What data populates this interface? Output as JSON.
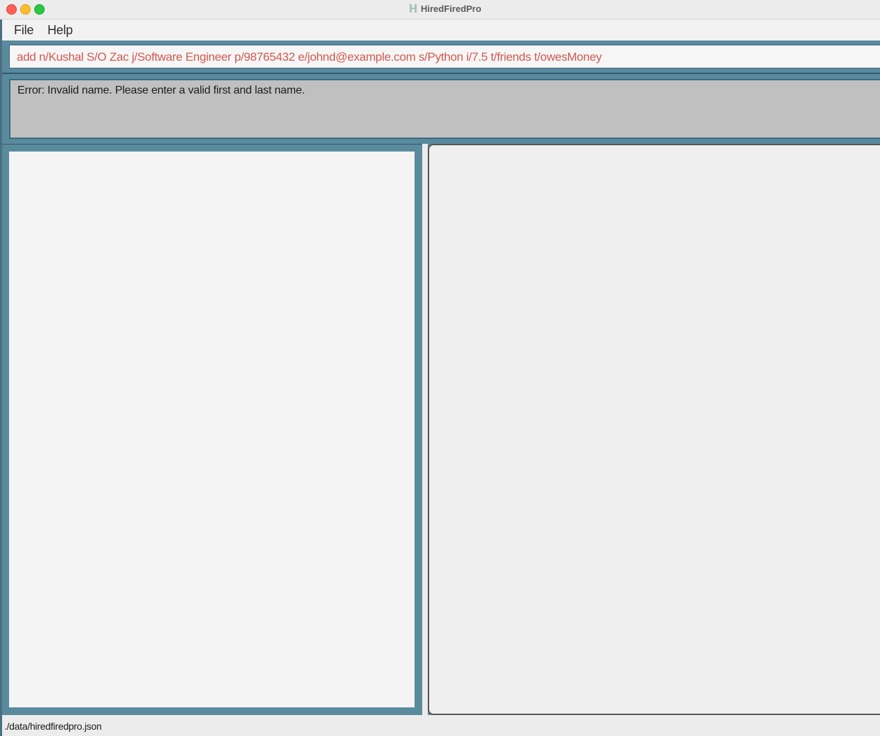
{
  "window": {
    "title": "HiredFiredPro",
    "icon": "app-logo-icon"
  },
  "menubar": {
    "items": [
      {
        "label": "File"
      },
      {
        "label": "Help"
      }
    ]
  },
  "command_box": {
    "value": "add n/Kushal S/O Zac j/Software Engineer p/98765432 e/johnd@example.com s/Python i/7.5 t/friends t/owesMoney",
    "text_color": "#d05a4f"
  },
  "result_display": {
    "message": "Error: Invalid name. Please enter a valid first and last name."
  },
  "status_bar": {
    "save_location": "./data/hiredfiredpro.json"
  },
  "colors": {
    "panel_accent": "#5a8a9e",
    "result_background": "#c0c0c0"
  }
}
